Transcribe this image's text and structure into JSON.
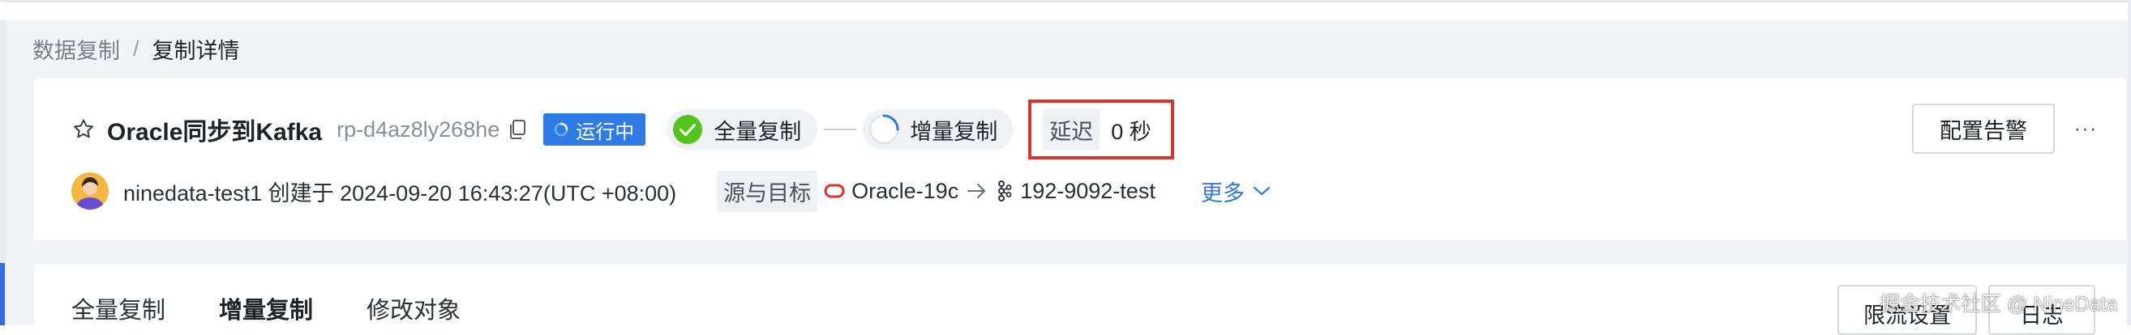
{
  "breadcrumb": {
    "parent": "数据复制",
    "separator": "/",
    "current": "复制详情"
  },
  "task": {
    "name": "Oracle同步到Kafka",
    "id": "rp-d4az8ly268he",
    "status": "运行中",
    "stages": {
      "full": "全量复制",
      "incremental": "增量复制"
    },
    "delay_label": "延迟",
    "delay_value": "0 秒",
    "creator_line": "ninedata-test1 创建于 2024-09-20 16:43:27(UTC +08:00)",
    "source_target_label": "源与目标",
    "source": "Oracle-19c",
    "target": "192-9092-test",
    "more_link": "更多"
  },
  "actions": {
    "alert_config": "配置告警",
    "more": "···"
  },
  "tabs": [
    {
      "label": "全量复制",
      "active": false
    },
    {
      "label": "增量复制",
      "active": true
    },
    {
      "label": "修改对象",
      "active": false
    }
  ],
  "panel_buttons": {
    "rate_limit": "限流设置",
    "log": "日志"
  },
  "watermark": "掘金技术社区 @ NineData",
  "colors": {
    "accent_blue": "#2e7be6",
    "success_green": "#52c41a",
    "highlight_red": "#d9342b",
    "page_bg": "#f2f4f7"
  },
  "icons": {
    "favorite": "star-outline-icon",
    "copy": "copy-icon",
    "status": "loading-spinner-icon",
    "full_done": "check-circle-icon",
    "incremental_running": "loading-ring-icon",
    "avatar": "user-avatar",
    "source": "oracle-icon",
    "flow": "arrow-right-icon",
    "target": "kafka-icon",
    "expand": "chevron-down-icon",
    "menu": "ellipsis-icon"
  }
}
